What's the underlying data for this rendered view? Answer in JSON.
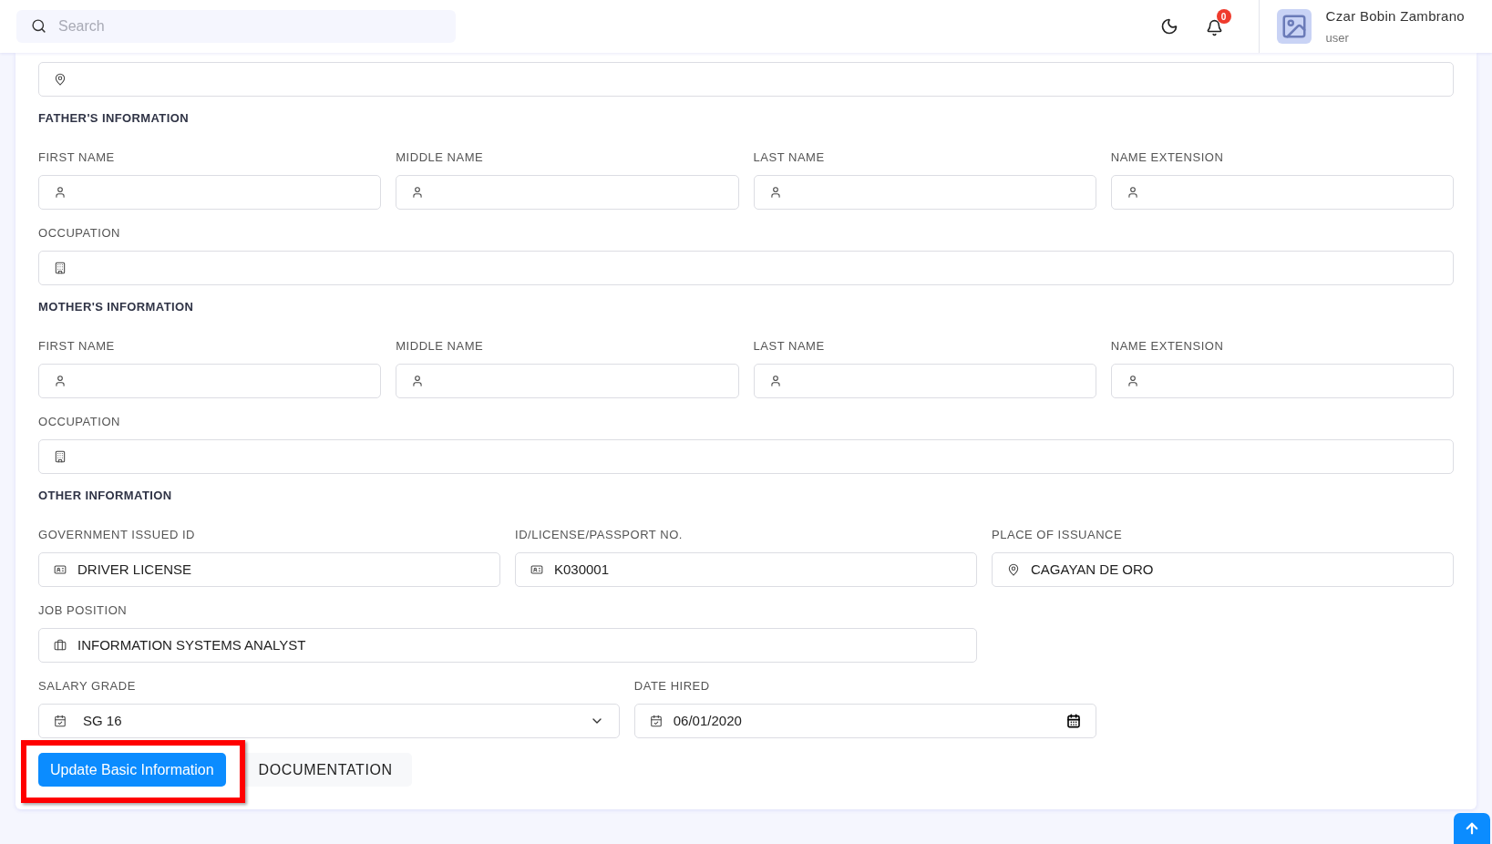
{
  "header": {
    "search": {
      "placeholder": "Search"
    },
    "notifications": {
      "count": "0"
    },
    "user": {
      "name": "Czar Bobin Zambrano",
      "role": "user"
    }
  },
  "sections": [
    {
      "title": "FATHER'S INFORMATION",
      "rows": [
        [
          {
            "label": "FIRST NAME",
            "kind": "name"
          },
          {
            "label": "MIDDLE NAME",
            "kind": "name"
          },
          {
            "label": "LAST NAME",
            "kind": "name"
          },
          {
            "label": "NAME EXTENSION",
            "kind": "name"
          }
        ],
        [
          {
            "label": "OCCUPATION",
            "kind": "occupation"
          }
        ]
      ]
    },
    {
      "title": "MOTHER'S INFORMATION",
      "rows": [
        [
          {
            "label": "FIRST NAME",
            "kind": "name"
          },
          {
            "label": "MIDDLE NAME",
            "kind": "name"
          },
          {
            "label": "LAST NAME",
            "kind": "name"
          },
          {
            "label": "NAME EXTENSION",
            "kind": "name"
          }
        ],
        [
          {
            "label": "OCCUPATION",
            "kind": "occupation"
          }
        ]
      ]
    },
    {
      "title": "OTHER INFORMATION",
      "rows": [
        [
          {
            "label": "GOVERNMENT ISSUED ID",
            "value": "DRIVER LICENSE",
            "kind": "id"
          },
          {
            "label": "ID/LICENSE/PASSPORT NO.",
            "value": "K030001",
            "kind": "id"
          },
          {
            "label": "PLACE OF ISSUANCE",
            "value": "CAGAYAN DE ORO",
            "kind": "place"
          }
        ],
        [
          {
            "label": "JOB POSITION",
            "value": "INFORMATION SYSTEMS ANALYST",
            "kind": "job"
          }
        ],
        [
          {
            "label": "SALARY GRADE",
            "value": "SG 16",
            "kind": "select"
          },
          {
            "label": "DATE HIRED",
            "value": "06/01/2020",
            "kind": "date"
          }
        ]
      ]
    }
  ],
  "buttons": [
    {
      "label": "Update Basic Information",
      "kind": "primary",
      "highlighted": true
    },
    {
      "label": "DOCUMENTATION",
      "kind": "secondary",
      "highlighted": false
    }
  ]
}
